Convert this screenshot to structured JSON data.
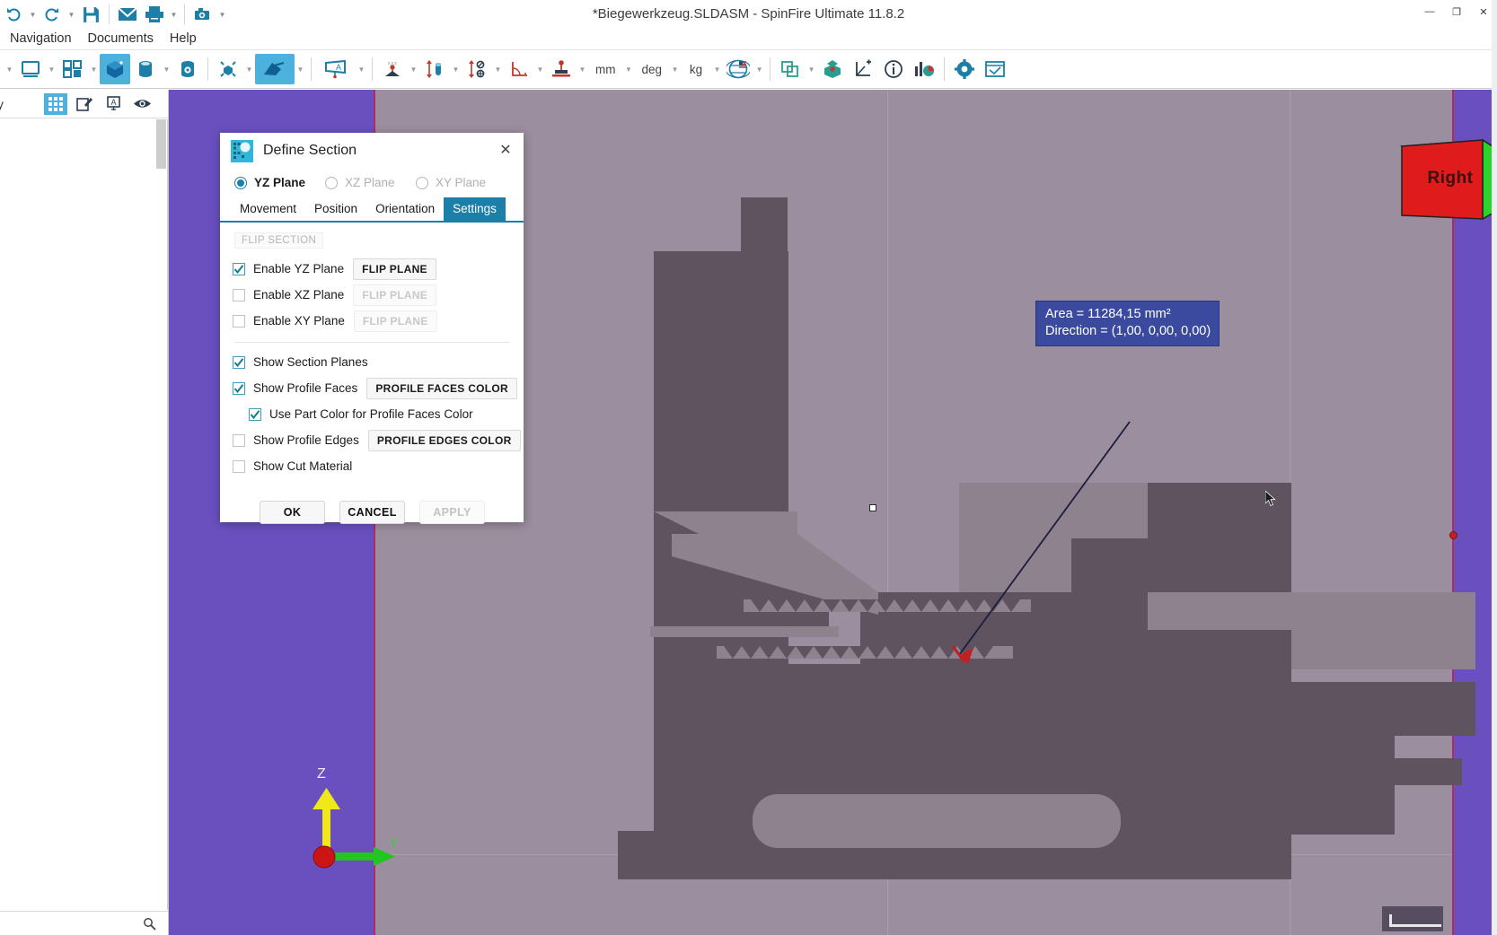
{
  "window": {
    "title": "*Biegewerkzeug.SLDASM - SpinFire Ultimate 11.8.2",
    "controls": [
      {
        "name": "minimize",
        "glyph": "—"
      },
      {
        "name": "maximize",
        "glyph": "❐"
      },
      {
        "name": "close",
        "glyph": "✕"
      }
    ]
  },
  "quick_access": [
    {
      "name": "undo-button",
      "icon": "undo-icon",
      "has_caret": true
    },
    {
      "name": "redo-button",
      "icon": "redo-icon",
      "has_caret": true
    },
    {
      "name": "save-button",
      "icon": "save-icon",
      "has_caret": false
    },
    {
      "name": "mail-button",
      "icon": "mail-icon",
      "has_caret": false
    },
    {
      "name": "print-button",
      "icon": "print-icon",
      "has_caret": true
    },
    {
      "name": "snapshot-button",
      "icon": "camera-icon",
      "has_caret": true
    }
  ],
  "menubar": {
    "items": [
      {
        "label": "Navigation",
        "name": "menu-navigation"
      },
      {
        "label": "Documents",
        "name": "menu-documents"
      },
      {
        "label": "Help",
        "name": "menu-help"
      }
    ]
  },
  "toolbar": {
    "units": {
      "length": "mm",
      "angle": "deg",
      "mass": "kg"
    },
    "buttons": [
      {
        "name": "display-mode-button",
        "icon": "monitor-icon",
        "active": false,
        "caret": true
      },
      {
        "name": "layout-button",
        "icon": "quad-layout-icon",
        "active": false,
        "caret": true
      },
      {
        "name": "shaded-view-button",
        "icon": "shaded-cube-icon",
        "active": true,
        "caret": false
      },
      {
        "name": "render-style-button",
        "icon": "cylinder-icon",
        "active": false,
        "caret": true
      },
      {
        "name": "scene-settings-button",
        "icon": "cylinder-gear-icon",
        "active": false,
        "caret": false
      },
      {
        "name": "explode-button",
        "icon": "explode-icon",
        "active": false,
        "caret": true
      },
      {
        "name": "section-button",
        "icon": "section-plane-icon",
        "active": true,
        "caret": true
      },
      {
        "name": "annotation-button",
        "icon": "note-icon",
        "active": false,
        "caret": true
      },
      {
        "name": "measure-point-button",
        "icon": "measure-point-icon",
        "active": false,
        "caret": true
      },
      {
        "name": "measure-distance-button",
        "icon": "measure-distance-icon",
        "active": false,
        "caret": true
      },
      {
        "name": "measure-diameter-button",
        "icon": "measure-diameter-icon",
        "active": false,
        "caret": true
      },
      {
        "name": "measure-angle-button",
        "icon": "measure-angle-icon",
        "active": false,
        "caret": true
      },
      {
        "name": "measure-surface-button",
        "icon": "measure-surface-icon",
        "active": false,
        "caret": true
      },
      {
        "name": "language-button",
        "icon": "globe-flag-icon",
        "active": false,
        "caret": true
      },
      {
        "name": "compare-button",
        "icon": "compare-shapes-icon",
        "active": false,
        "caret": true
      },
      {
        "name": "assembly-button",
        "icon": "assembly-icon",
        "active": false,
        "caret": false
      },
      {
        "name": "coordinate-button",
        "icon": "axis-plus-icon",
        "active": false,
        "caret": false
      },
      {
        "name": "info-button",
        "icon": "info-icon",
        "active": false,
        "caret": false
      },
      {
        "name": "statistics-button",
        "icon": "chart-icon",
        "active": false,
        "caret": false
      },
      {
        "name": "settings-button",
        "icon": "gear-icon",
        "active": false,
        "caret": false
      },
      {
        "name": "about-button",
        "icon": "window-icon",
        "active": false,
        "caret": false
      }
    ]
  },
  "left_panel": {
    "tab_label": "bly",
    "icons": [
      {
        "name": "panel-grid-icon",
        "glyph": "grid",
        "active": true
      },
      {
        "name": "panel-edit-icon",
        "glyph": "edit",
        "active": false
      },
      {
        "name": "panel-text-icon",
        "glyph": "text",
        "active": false
      },
      {
        "name": "panel-visibility-icon",
        "glyph": "eye",
        "active": false
      }
    ],
    "footer_icon": "search-icon"
  },
  "viewport": {
    "background_color": "#9b8e9e",
    "section_plane_color": "#6a50bf",
    "plane_edge_color": "#b02a6a",
    "annotation": {
      "line1": "Area = 11284,15 mm²",
      "line2": "Direction = (1,00, 0,00, 0,00)",
      "background_color": "#3b4a9e",
      "text_color": "#ffffff"
    },
    "view_cube": {
      "label": "Right",
      "front_color": "#e01b1b",
      "top_color": "#f0e818",
      "side_color": "#2ad42a"
    },
    "axis_triad": {
      "z_label": "Z",
      "y_label": "Y",
      "z_color": "#f0e818",
      "y_color": "#22c522",
      "origin_color": "#cc1414"
    }
  },
  "dialog": {
    "title": "Define Section",
    "close_glyph": "✕",
    "plane_options": [
      {
        "label": "YZ Plane",
        "name": "radio-yz-plane",
        "checked": true
      },
      {
        "label": "XZ Plane",
        "name": "radio-xz-plane",
        "checked": false
      },
      {
        "label": "XY Plane",
        "name": "radio-xy-plane",
        "checked": false
      }
    ],
    "tabs": [
      {
        "label": "Movement",
        "name": "tab-movement",
        "active": false
      },
      {
        "label": "Position",
        "name": "tab-position",
        "active": false
      },
      {
        "label": "Orientation",
        "name": "tab-orientation",
        "active": false
      },
      {
        "label": "Settings",
        "name": "tab-settings",
        "active": true
      }
    ],
    "flip_section_header": "FLIP SECTION",
    "flip_rows": [
      {
        "label": "Enable YZ Plane",
        "checked": true,
        "button": "FLIP PLANE",
        "button_enabled": true,
        "chk_name": "checkbox-enable-yz-plane",
        "btn_name": "flip-yz-plane-button"
      },
      {
        "label": "Enable XZ Plane",
        "checked": false,
        "button": "FLIP PLANE",
        "button_enabled": false,
        "chk_name": "checkbox-enable-xz-plane",
        "btn_name": "flip-xz-plane-button"
      },
      {
        "label": "Enable XY Plane",
        "checked": false,
        "button": "FLIP PLANE",
        "button_enabled": false,
        "chk_name": "checkbox-enable-xy-plane",
        "btn_name": "flip-xy-plane-button"
      }
    ],
    "option_rows": [
      {
        "label": "Show Section Planes",
        "checked": true,
        "indent": false,
        "button": null,
        "chk_name": "checkbox-show-section-planes",
        "btn_name": null,
        "button_enabled": false
      },
      {
        "label": "Show Profile Faces",
        "checked": true,
        "indent": false,
        "button": "PROFILE FACES COLOR",
        "chk_name": "checkbox-show-profile-faces",
        "btn_name": "profile-faces-color-button",
        "button_enabled": true
      },
      {
        "label": "Use Part Color for Profile Faces Color",
        "checked": true,
        "indent": true,
        "button": null,
        "chk_name": "checkbox-use-part-color",
        "btn_name": null,
        "button_enabled": false
      },
      {
        "label": "Show Profile Edges",
        "checked": false,
        "indent": false,
        "button": "PROFILE EDGES COLOR",
        "chk_name": "checkbox-show-profile-edges",
        "btn_name": "profile-edges-color-button",
        "button_enabled": true
      },
      {
        "label": "Show Cut Material",
        "checked": false,
        "indent": false,
        "button": null,
        "chk_name": "checkbox-show-cut-material",
        "btn_name": null,
        "button_enabled": false
      }
    ],
    "actions": [
      {
        "label": "OK",
        "name": "ok-button",
        "enabled": true
      },
      {
        "label": "CANCEL",
        "name": "cancel-button",
        "enabled": true
      },
      {
        "label": "APPLY",
        "name": "apply-button",
        "enabled": false
      }
    ]
  }
}
